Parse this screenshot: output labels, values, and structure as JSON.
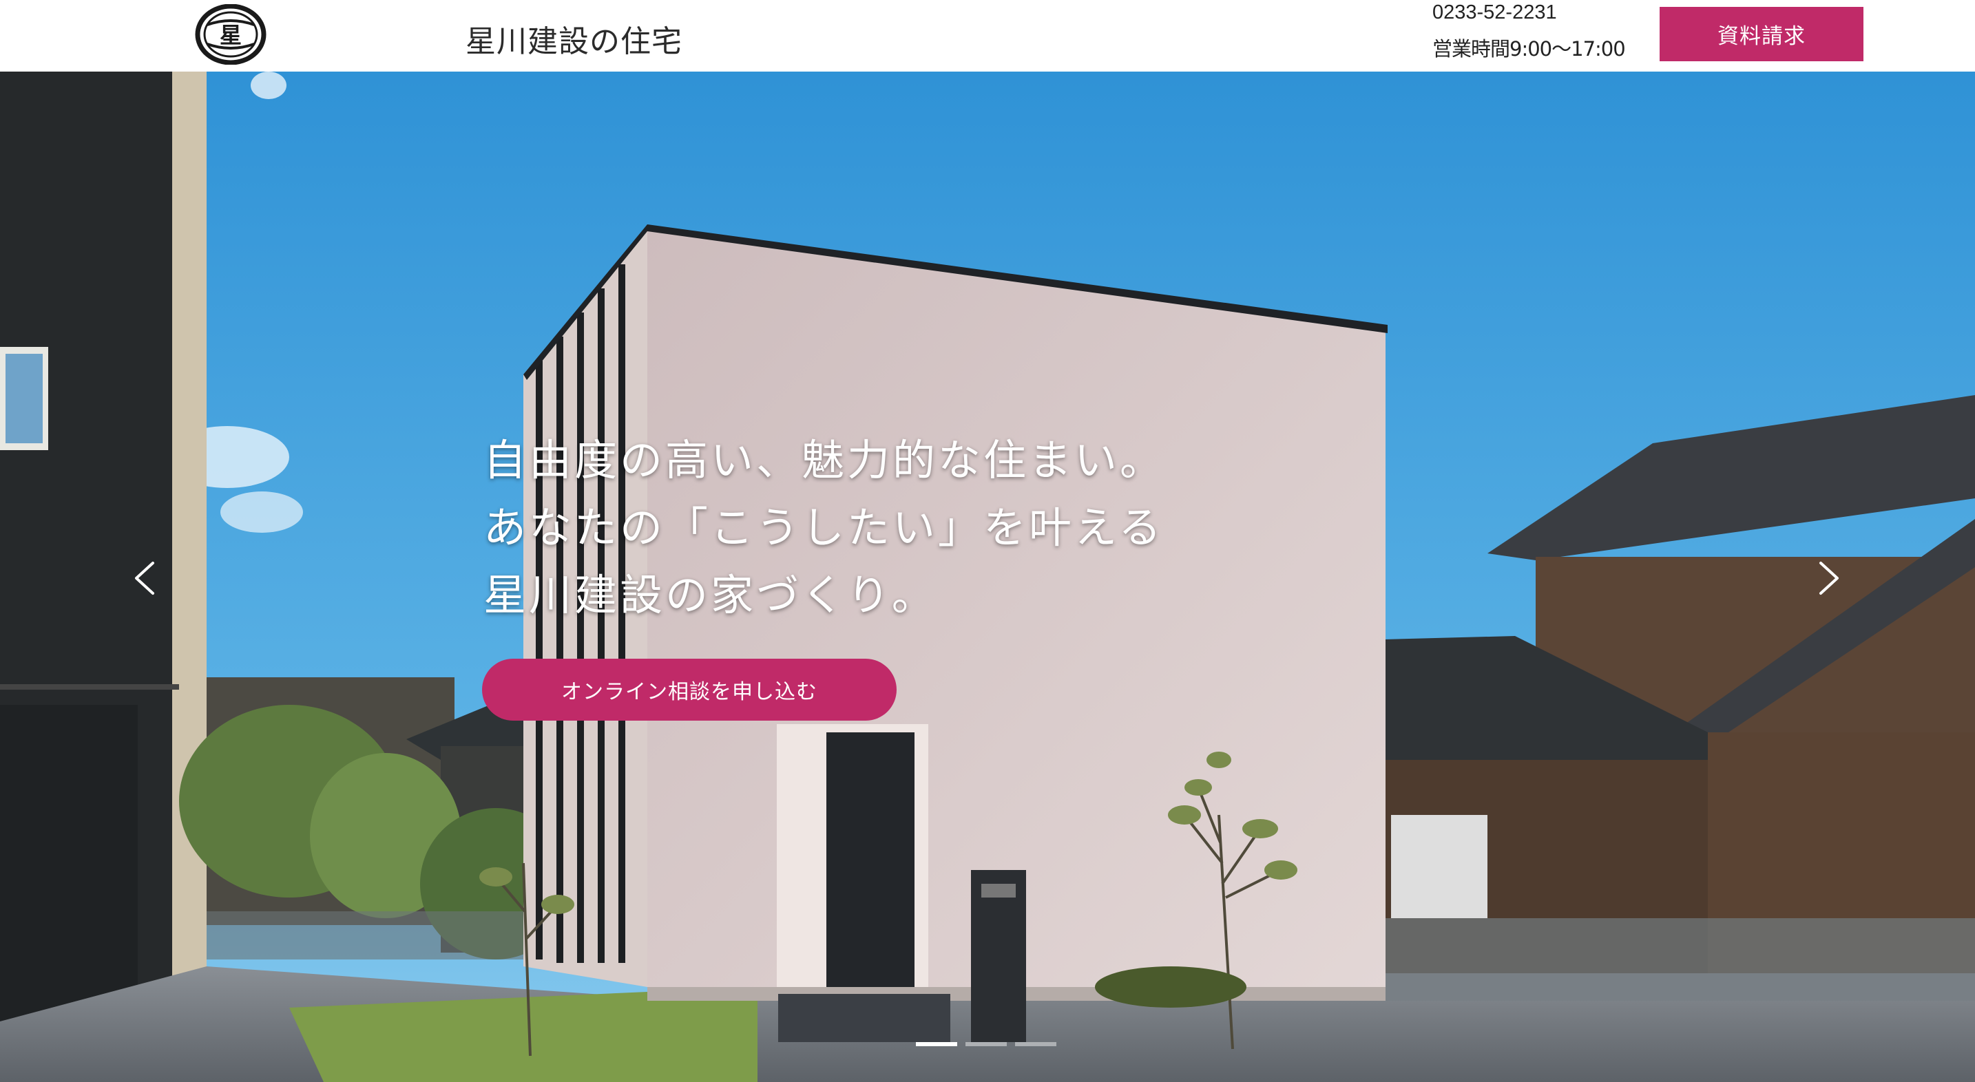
{
  "header": {
    "logo_char": "星",
    "site_title": "星川建設の住宅",
    "phone": "0233-52-2231",
    "hours": "営業時間9:00〜17:00",
    "request_button": "資料請求"
  },
  "hero": {
    "headline_lines": [
      "自由度の高い、魅力的な住まい。",
      "あなたの「こうしたい」を叶える",
      "星川建設の家づくり。"
    ],
    "cta_button": "オンライン相談を申し込む",
    "prev_icon": "chevron-left-icon",
    "next_icon": "chevron-right-icon",
    "slides_count": 3,
    "active_slide": 1
  },
  "colors": {
    "accent": "#c02a68",
    "sky": "#3a9fdc",
    "header_bg": "#ffffff"
  }
}
